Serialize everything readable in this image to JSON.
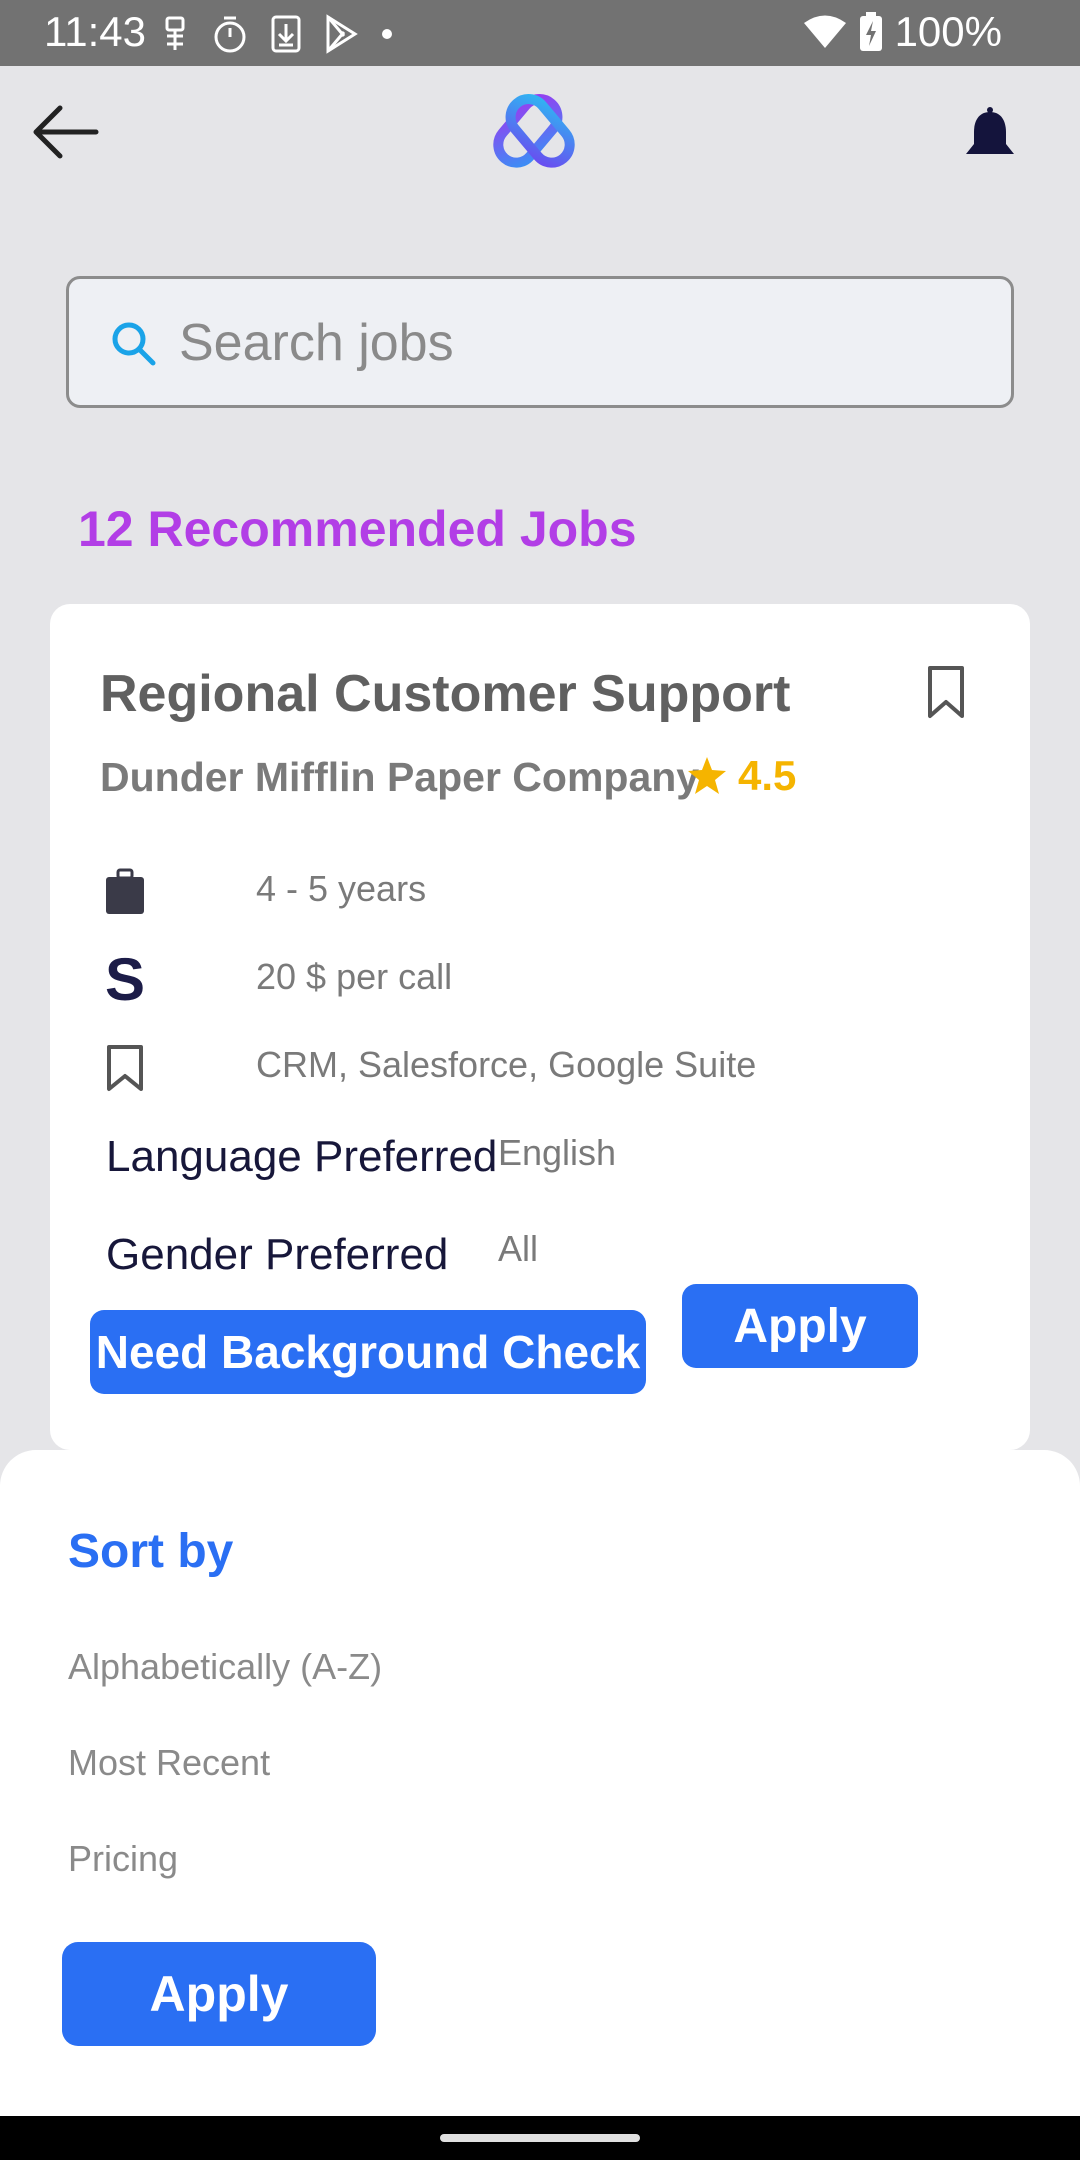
{
  "status_bar": {
    "time": "11:43",
    "battery": "100%",
    "icons_left": [
      "usb-icon",
      "timer-icon",
      "download-icon",
      "play-store-icon",
      "dot-icon"
    ],
    "icons_right": [
      "wifi-icon",
      "battery-charging-icon"
    ]
  },
  "app_bar": {
    "back_icon": "arrow-left-icon",
    "logo_icon": "app-logo-icon",
    "notification_icon": "bell-icon"
  },
  "search": {
    "placeholder": "Search jobs",
    "value": ""
  },
  "section": {
    "title": "12 Recommended Jobs"
  },
  "job": {
    "title": "Regional Customer Support",
    "company": "Dunder Mifflin Paper Company",
    "rating": "4.5",
    "experience": "4 - 5 years",
    "pay": "20 $ per call",
    "skills": "CRM, Salesforce, Google Suite",
    "language_label": "Language Preferred",
    "language_value": "English",
    "gender_label": "Gender Preferred",
    "gender_value": "All",
    "background_check": "Need Background Check",
    "apply_label": "Apply"
  },
  "sort_sheet": {
    "title": "Sort by",
    "options": [
      "Alphabetically (A-Z)",
      "Most Recent",
      "Pricing"
    ],
    "apply_label": "Apply"
  },
  "colors": {
    "accent_blue": "#2a6ff3",
    "title_purple": "#b23ee6",
    "rating_gold": "#f5b400",
    "status_bar": "#727272"
  }
}
